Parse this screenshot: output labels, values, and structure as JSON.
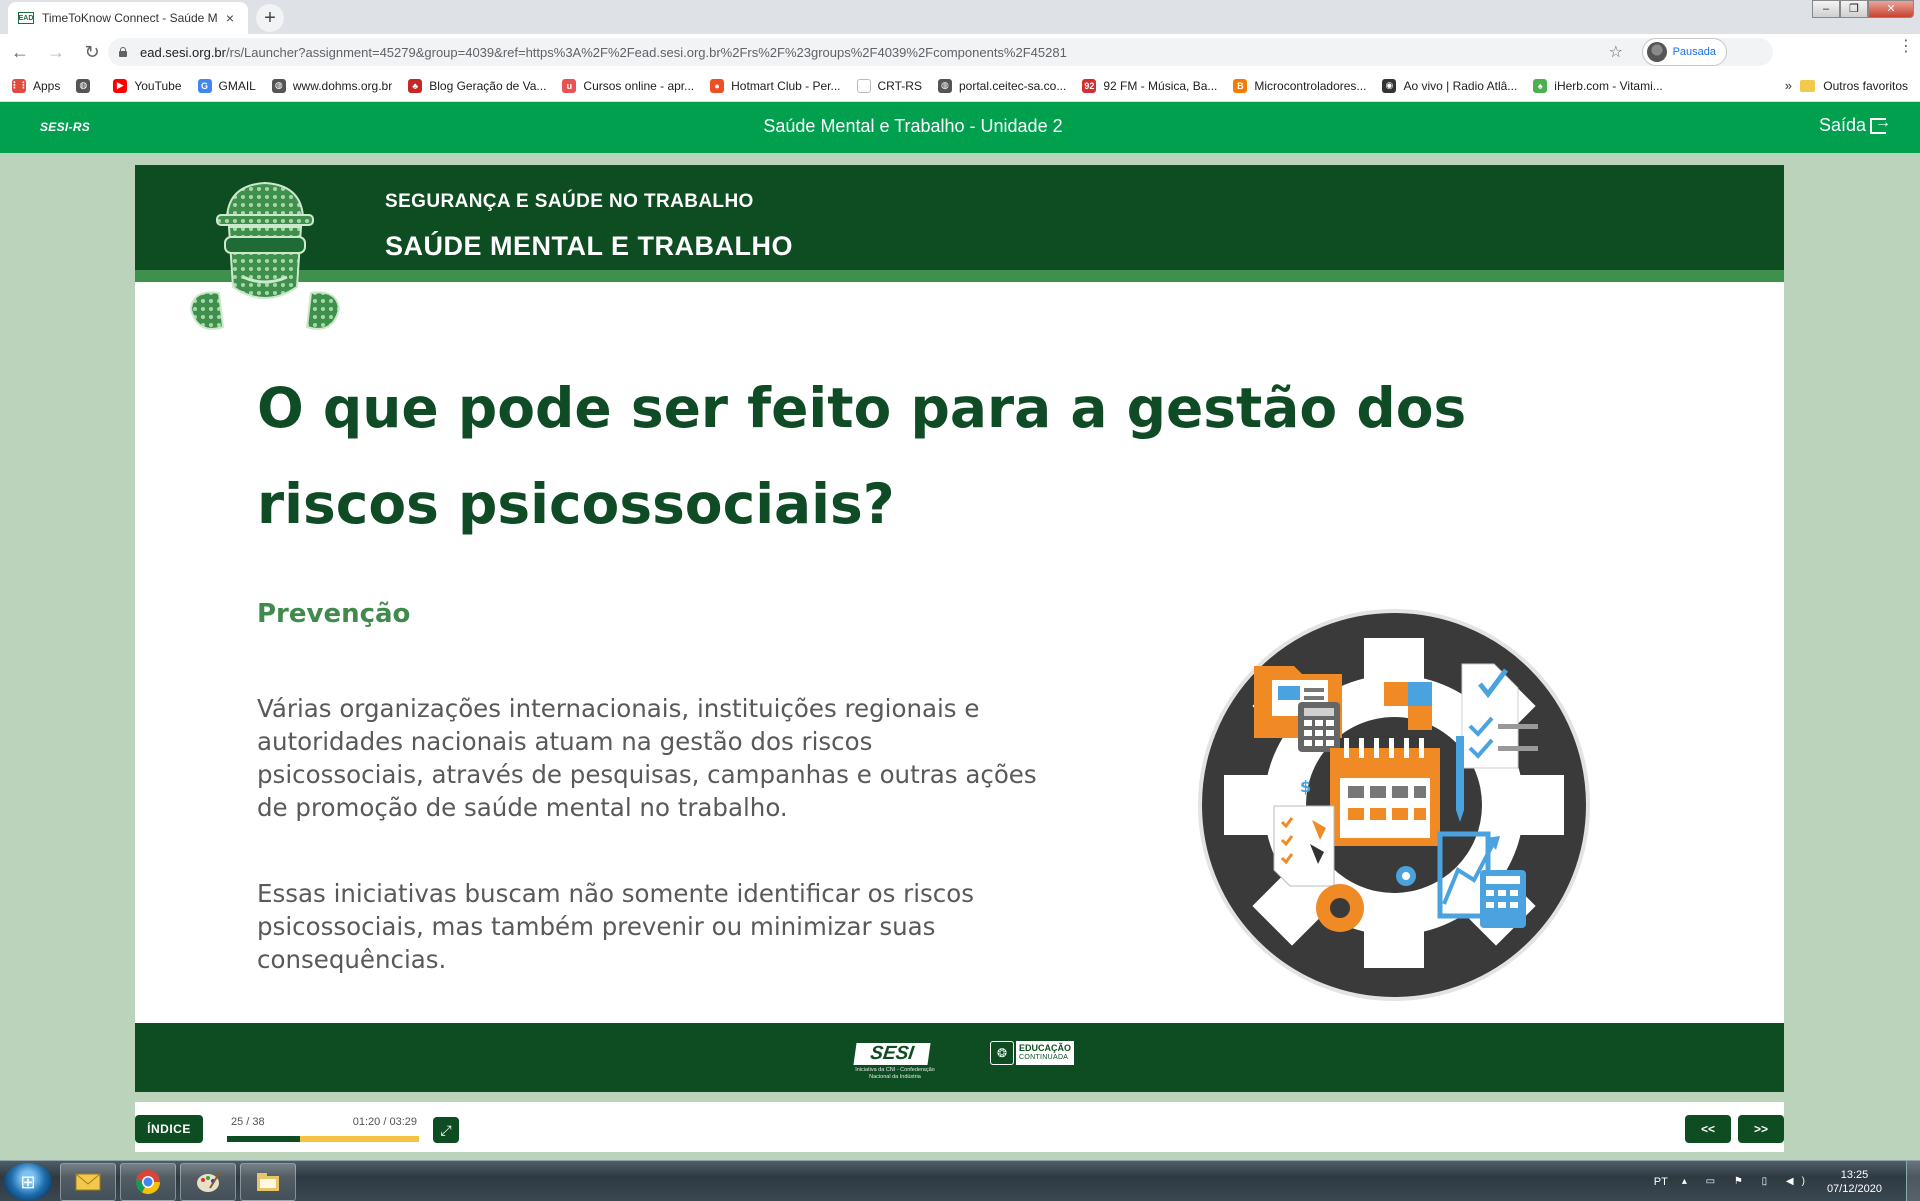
{
  "browser": {
    "tab_icon_text": "EAD",
    "tab_title": "TimeToKnow Connect - Saúde M",
    "tab_close": "×",
    "new_tab": "+",
    "win_minimize": "‒",
    "win_maximize": "❐",
    "win_close": "✕",
    "back": "←",
    "forward": "→",
    "reload": "↻",
    "url_host": "ead.sesi.org.br",
    "url_path": "/rs/Launcher?assignment=45279&group=4039&ref=https%3A%2F%2Fead.sesi.org.br%2Frs%2F%23groups%2F4039%2Fcomponents%2F45281",
    "star": "☆",
    "profile_label": "Pausada",
    "menu": "⋮"
  },
  "bookmarks": {
    "items": [
      {
        "label": "Apps",
        "icon": "apps-grid-icon",
        "color": "#e04a3f",
        "glyph": "⋮⋮"
      },
      {
        "label": "",
        "icon": "world-icon",
        "color": "#555555",
        "glyph": "◍"
      },
      {
        "label": "YouTube",
        "icon": "youtube-icon",
        "color": "#ff0000",
        "glyph": "▶"
      },
      {
        "label": "GMAIL",
        "icon": "google-icon",
        "color": "#4285f4",
        "glyph": "G"
      },
      {
        "label": "www.dohms.org.br",
        "icon": "world-icon",
        "color": "#555555",
        "glyph": "◍"
      },
      {
        "label": "Blog Geração de Va...",
        "icon": "blog-icon",
        "color": "#c62828",
        "glyph": "♣"
      },
      {
        "label": "Cursos online - apr...",
        "icon": "udemy-icon",
        "color": "#ec5252",
        "glyph": "u"
      },
      {
        "label": "Hotmart Club - Per...",
        "icon": "hotmart-icon",
        "color": "#f04e23",
        "glyph": "●"
      },
      {
        "label": "CRT-RS",
        "icon": "blank-page-icon",
        "color": "#ffffff",
        "glyph": ""
      },
      {
        "label": "portal.ceitec-sa.co...",
        "icon": "world-icon",
        "color": "#555555",
        "glyph": "◍"
      },
      {
        "label": "92 FM - Música, Ba...",
        "icon": "radio-92-icon",
        "color": "#d32f2f",
        "glyph": "92"
      },
      {
        "label": "Microcontroladores...",
        "icon": "blogger-icon",
        "color": "#f57c00",
        "glyph": "B"
      },
      {
        "label": "Ao vivo | Radio Atlâ...",
        "icon": "radio-icon",
        "color": "#333333",
        "glyph": "◉"
      },
      {
        "label": "iHerb.com - Vitami...",
        "icon": "iherb-icon",
        "color": "#4caf50",
        "glyph": "♠"
      }
    ],
    "more": "»",
    "other_label": "Outros favoritos"
  },
  "lms": {
    "logo": "SESI-RS",
    "title": "Saúde Mental e Trabalho - Unidade 2",
    "exit_label": "Saída"
  },
  "slide": {
    "subheading": "SEGURANÇA E SAÚDE NO TRABALHO",
    "course_title": "SAÚDE MENTAL E TRABALHO",
    "heading": "O que pode ser feito para a gestão dos riscos psicossociais?",
    "section_title": "Prevenção",
    "paragraph1": "Várias organizações internacionais, instituições regionais e autoridades nacionais atuam na gestão dos riscos psicossociais, através de pesquisas, campanhas e outras ações de promoção de saúde mental no trabalho.",
    "paragraph2": "Essas iniciativas buscam não somente identificar os riscos psicossociais, mas também prevenir ou minimizar suas consequências."
  },
  "footer": {
    "sesi_logo": "SESI",
    "sesi_tagline": "Iniciativa da CNI - Confederação Nacional da Indústria",
    "edu_line1": "EDUCAÇÃO",
    "edu_line2": "CONTINUADA"
  },
  "player": {
    "indice_label": "ÍNDICE",
    "slide_count": "25 / 38",
    "time": "01:20 / 03:29",
    "progress_fraction": 0.38,
    "expand": "⤢",
    "prev_label": "<<",
    "next_label": ">>"
  },
  "taskbar": {
    "lang": "PT",
    "tray_icons": "▴ ▭ ⚑ ▯ ◀)",
    "time": "13:25",
    "date": "07/12/2020"
  },
  "colors": {
    "lms_green": "#00a04f",
    "dark_green": "#0d4d21",
    "heading_green": "#0f4c26",
    "section_green": "#3f8a4c",
    "progress_yellow": "#f6c244"
  }
}
